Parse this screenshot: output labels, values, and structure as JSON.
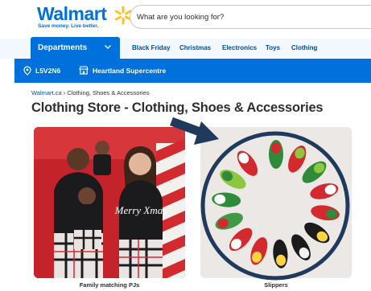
{
  "header": {
    "logo_text": "Walmart",
    "tagline": "Save money. Live better.",
    "search_placeholder": "What are you looking for?"
  },
  "nav": {
    "departments_label": "Departments",
    "links": [
      "Black Friday",
      "Christmas",
      "Electronics",
      "Toys",
      "Clothing"
    ]
  },
  "location": {
    "postal_code": "L5V2N6",
    "store": "Heartland Supercentre"
  },
  "breadcrumb": {
    "home": "Walmart.ca",
    "separator": "›",
    "current": "Clothing, Shoes & Accessories"
  },
  "page_title": "Clothing Store - Clothing, Shoes & Accessories",
  "tiles": [
    {
      "caption": "Family matching PJs",
      "shirt_text": "Merry Xmas"
    },
    {
      "caption": "Slippers"
    }
  ],
  "colors": {
    "brand_blue": "#0071dc",
    "spark_yellow": "#ffc220",
    "highlight_navy": "#1f3a5c",
    "nav_link": "#004f9a"
  }
}
